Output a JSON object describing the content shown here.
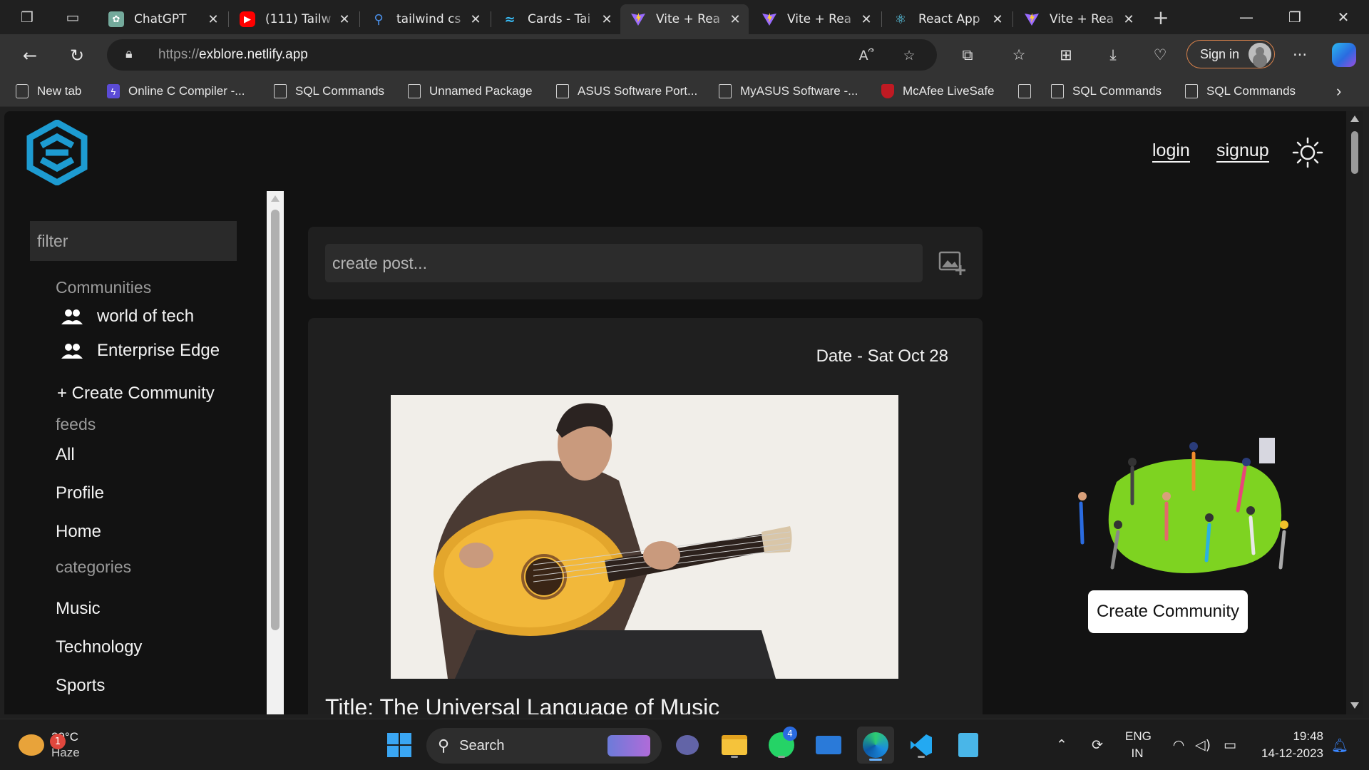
{
  "browser": {
    "tabs": [
      {
        "label": "ChatGPT",
        "icon": "chatgpt-icon"
      },
      {
        "label": "(111) Tailw",
        "icon": "youtube-icon"
      },
      {
        "label": "tailwind cs",
        "icon": "search-icon"
      },
      {
        "label": "Cards - Tai",
        "icon": "tailwind-icon"
      },
      {
        "label": "Vite + Rea",
        "icon": "vite-icon",
        "active": true
      },
      {
        "label": "Vite + Rea",
        "icon": "vite-icon"
      },
      {
        "label": "React App",
        "icon": "react-icon"
      },
      {
        "label": "Vite + Rea",
        "icon": "vite-icon"
      }
    ],
    "url_prefix": "https://",
    "url_host": "exblore.netlify.app",
    "sign_in_label": "Sign in",
    "bookmarks": [
      {
        "label": "New tab",
        "icon": "newtab"
      },
      {
        "label": "Online C Compiler -...",
        "icon": "lightning"
      },
      {
        "label": "SQL Commands",
        "icon": "page"
      },
      {
        "label": "Unnamed Package",
        "icon": "page"
      },
      {
        "label": "ASUS Software Port...",
        "icon": "page"
      },
      {
        "label": "MyASUS Software -...",
        "icon": "page"
      },
      {
        "label": "McAfee LiveSafe",
        "icon": "shield"
      },
      {
        "label": "",
        "icon": "page"
      },
      {
        "label": "SQL Commands",
        "icon": "page"
      },
      {
        "label": "SQL Commands",
        "icon": "page"
      }
    ]
  },
  "site": {
    "header": {
      "login_label": "login",
      "signup_label": "signup"
    },
    "sidebar": {
      "filter_placeholder": "filter",
      "communities_heading": "Communities",
      "communities": [
        "world of tech",
        "Enterprise Edge"
      ],
      "create_community_label": "+ Create Community",
      "feeds_heading": "feeds",
      "feeds": [
        "All",
        "Profile",
        "Home"
      ],
      "categories_heading": "categories",
      "categories": [
        "Music",
        "Technology",
        "Sports"
      ]
    },
    "composer": {
      "placeholder": "create post..."
    },
    "post": {
      "date": "Date - Sat Oct 28",
      "title": "Title: The Universal Language of Music"
    },
    "promo": {
      "button_label": "Create Community"
    }
  },
  "taskbar": {
    "weather_temp": "29°C",
    "weather_desc": "Haze",
    "weather_badge": "1",
    "search_label": "Search",
    "whatsapp_badge": "4",
    "lang_1": "ENG",
    "lang_2": "IN",
    "time": "19:48",
    "date": "14-12-2023"
  },
  "colors": {
    "page_bg": "#121212",
    "card_bg": "#1f1f1f",
    "logo_teal": "#1d9bd1",
    "signin_border": "#d9824b"
  }
}
